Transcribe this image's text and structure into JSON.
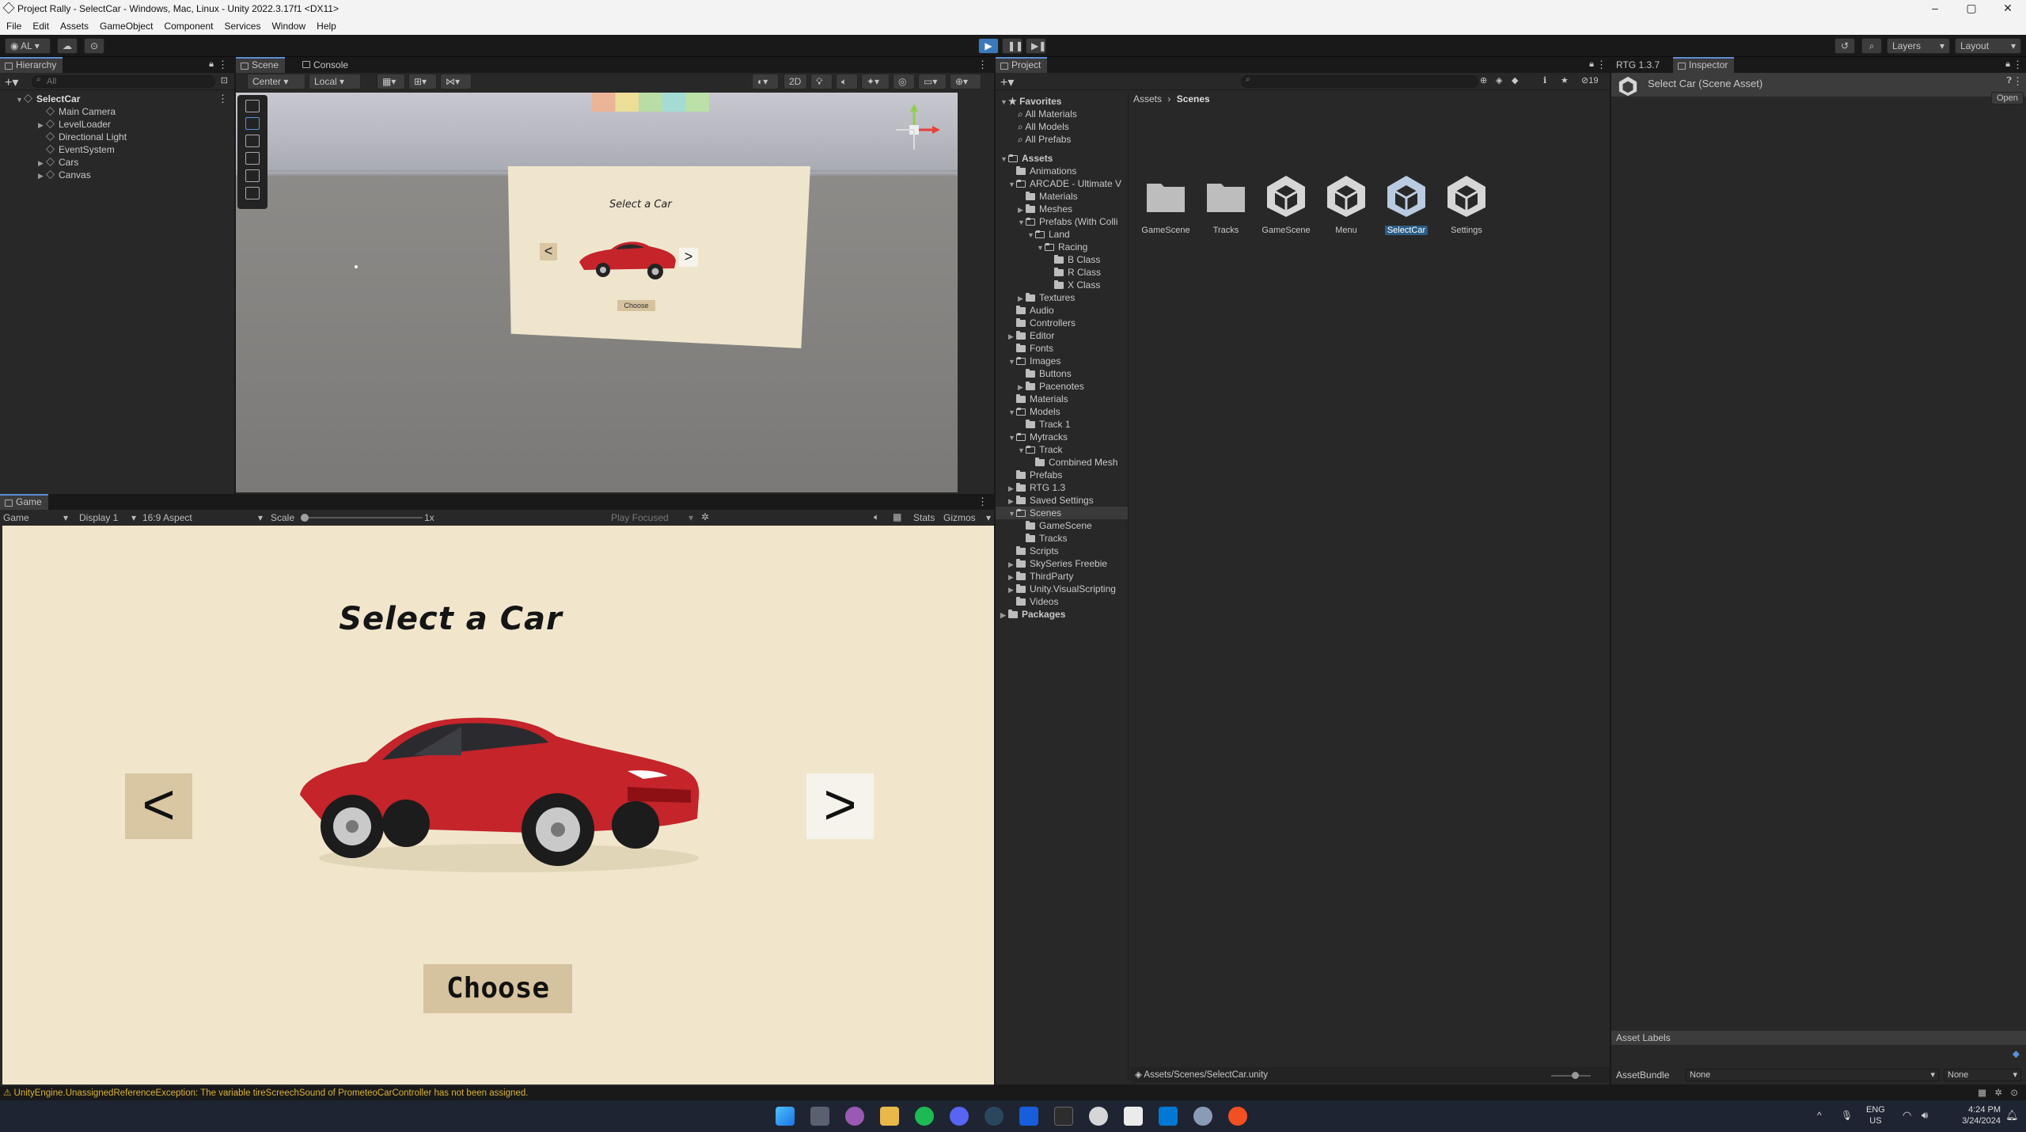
{
  "window": {
    "title": "Project Rally - SelectCar - Windows, Mac, Linux - Unity 2022.3.17f1 <DX11>"
  },
  "menu": [
    "File",
    "Edit",
    "Assets",
    "GameObject",
    "Component",
    "Services",
    "Window",
    "Help"
  ],
  "toolbar": {
    "account": "AL",
    "layers": "Layers",
    "layout": "Layout"
  },
  "hierarchy": {
    "tab": "Hierarchy",
    "search_placeholder": "All",
    "scene": "SelectCar",
    "items": [
      "Main Camera",
      "LevelLoader",
      "Directional Light",
      "EventSystem",
      "Cars",
      "Canvas"
    ]
  },
  "scene_view": {
    "tabs": [
      "Scene",
      "Console"
    ],
    "pivot": "Center",
    "space": "Local",
    "mode_2d": "2D",
    "canvas_title": "Select a Car",
    "canvas_left": "<",
    "canvas_right": ">",
    "canvas_choose": "Choose"
  },
  "game_view": {
    "tab": "Game",
    "mode": "Game",
    "display": "Display 1",
    "aspect": "16:9 Aspect",
    "scale_label": "Scale",
    "scale_value": "1x",
    "play_focused": "Play Focused",
    "stats": "Stats",
    "gizmos": "Gizmos",
    "title": "Select a Car",
    "left_button": "<",
    "right_button": ">",
    "choose_button": "Choose"
  },
  "project": {
    "tab": "Project",
    "favorites_label": "Favorites",
    "favorites": [
      "All Materials",
      "All Models",
      "All Prefabs"
    ],
    "assets_label": "Assets",
    "tree": [
      "Animations",
      "ARCADE - Ultimate V",
      "Materials",
      "Meshes",
      "Prefabs (With Colli",
      "Land",
      "Racing",
      "B Class",
      "R Class",
      "X Class",
      "Textures",
      "Audio",
      "Controllers",
      "Editor",
      "Fonts",
      "Images",
      "Buttons",
      "Pacenotes",
      "Materials",
      "Models",
      "Track 1",
      "Mytracks",
      "Track",
      "Combined Mesh",
      "Prefabs",
      "RTG 1.3",
      "Saved Settings",
      "Scenes",
      "GameScene",
      "Tracks",
      "Scripts",
      "SkySeries Freebie",
      "ThirdParty",
      "Unity.VisualScripting",
      "Videos"
    ],
    "packages_label": "Packages",
    "breadcrumb": [
      "Assets",
      "Scenes"
    ],
    "assets": [
      "GameScene",
      "Tracks",
      "GameScene",
      "Menu",
      "SelectCar",
      "Settings"
    ],
    "path": "Assets/Scenes/SelectCar.unity",
    "hidden_count": "19"
  },
  "inspector": {
    "tabs": [
      "RTG 1.3.7",
      "Inspector"
    ],
    "title": "Select Car (Scene Asset)",
    "open_button": "Open",
    "asset_labels": "Asset Labels",
    "assetbundle_label": "AssetBundle",
    "assetbundle_value": "None",
    "variant_value": "None"
  },
  "status": {
    "message": "UnityEngine.UnassignedReferenceException: The variable tireScreechSound of PrometeoCarController has not been assigned."
  },
  "taskbar": {
    "lang": "ENG",
    "region": "US",
    "time": "4:24 PM",
    "date": "3/24/2024"
  },
  "colors": {
    "accent": "#3a79bb",
    "game_bg": "#f1e6cc",
    "car_red": "#c4242a",
    "warning": "#d9b33a"
  }
}
